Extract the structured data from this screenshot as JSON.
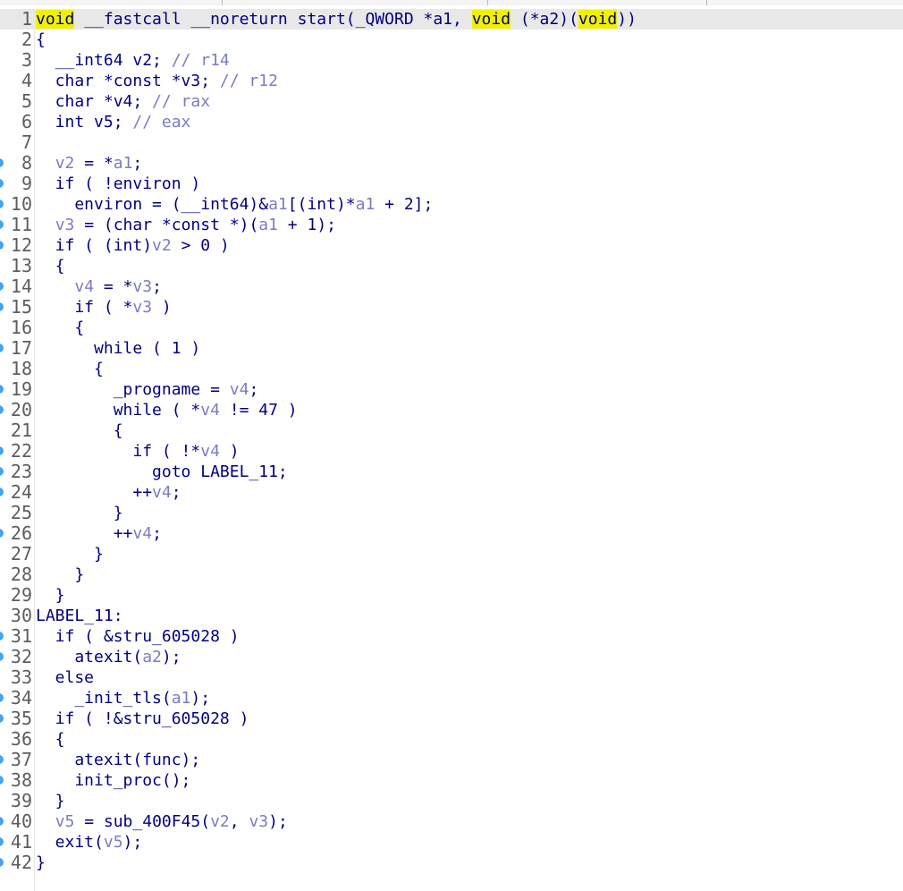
{
  "colors": {
    "highlight": "#f0f000",
    "breakpoint_dot": "#45a3f0",
    "identifier": "#000080",
    "variable": "#7b7bc4",
    "line_number": "#5d5d5d",
    "current_line": "#e8e8e8"
  },
  "editor": {
    "lines": [
      {
        "n": "1",
        "bp": false,
        "current": true,
        "tokens": [
          [
            "hl",
            "void"
          ],
          [
            "tx",
            " __fastcall __noreturn start(_QWORD *a1, "
          ],
          [
            "hl",
            "void"
          ],
          [
            "tx",
            " (*a2)("
          ],
          [
            "hl",
            "void"
          ],
          [
            "tx",
            "))"
          ]
        ]
      },
      {
        "n": "2",
        "bp": false,
        "tokens": [
          [
            "tx",
            "{"
          ]
        ]
      },
      {
        "n": "3",
        "bp": false,
        "tokens": [
          [
            "tx",
            "  __int64 v2; "
          ],
          [
            "cm",
            "// r14"
          ]
        ]
      },
      {
        "n": "4",
        "bp": false,
        "tokens": [
          [
            "tx",
            "  char *const *v3; "
          ],
          [
            "cm",
            "// r12"
          ]
        ]
      },
      {
        "n": "5",
        "bp": false,
        "tokens": [
          [
            "tx",
            "  char *v4; "
          ],
          [
            "cm",
            "// rax"
          ]
        ]
      },
      {
        "n": "6",
        "bp": false,
        "tokens": [
          [
            "tx",
            "  int v5; "
          ],
          [
            "cm",
            "// eax"
          ]
        ]
      },
      {
        "n": "7",
        "bp": false,
        "tokens": []
      },
      {
        "n": "8",
        "bp": true,
        "tokens": [
          [
            "tx",
            "  "
          ],
          [
            "var",
            "v2"
          ],
          [
            "tx",
            " = *"
          ],
          [
            "var",
            "a1"
          ],
          [
            "tx",
            ";"
          ]
        ]
      },
      {
        "n": "9",
        "bp": true,
        "tokens": [
          [
            "tx",
            "  if ( !environ )"
          ]
        ]
      },
      {
        "n": "10",
        "bp": true,
        "tokens": [
          [
            "tx",
            "    environ = (__int64)&"
          ],
          [
            "var",
            "a1"
          ],
          [
            "tx",
            "[(int)*"
          ],
          [
            "var",
            "a1"
          ],
          [
            "tx",
            " + 2];"
          ]
        ]
      },
      {
        "n": "11",
        "bp": true,
        "tokens": [
          [
            "tx",
            "  "
          ],
          [
            "var",
            "v3"
          ],
          [
            "tx",
            " = (char *const *)("
          ],
          [
            "var",
            "a1"
          ],
          [
            "tx",
            " + 1);"
          ]
        ]
      },
      {
        "n": "12",
        "bp": true,
        "tokens": [
          [
            "tx",
            "  if ( (int)"
          ],
          [
            "var",
            "v2"
          ],
          [
            "tx",
            " > 0 )"
          ]
        ]
      },
      {
        "n": "13",
        "bp": false,
        "tokens": [
          [
            "tx",
            "  {"
          ]
        ]
      },
      {
        "n": "14",
        "bp": true,
        "tokens": [
          [
            "tx",
            "    "
          ],
          [
            "var",
            "v4"
          ],
          [
            "tx",
            " = *"
          ],
          [
            "var",
            "v3"
          ],
          [
            "tx",
            ";"
          ]
        ]
      },
      {
        "n": "15",
        "bp": true,
        "tokens": [
          [
            "tx",
            "    if ( *"
          ],
          [
            "var",
            "v3"
          ],
          [
            "tx",
            " )"
          ]
        ]
      },
      {
        "n": "16",
        "bp": false,
        "tokens": [
          [
            "tx",
            "    {"
          ]
        ]
      },
      {
        "n": "17",
        "bp": true,
        "tokens": [
          [
            "tx",
            "      while ( 1 )"
          ]
        ]
      },
      {
        "n": "18",
        "bp": false,
        "tokens": [
          [
            "tx",
            "      {"
          ]
        ]
      },
      {
        "n": "19",
        "bp": true,
        "tokens": [
          [
            "tx",
            "        _progname = "
          ],
          [
            "var",
            "v4"
          ],
          [
            "tx",
            ";"
          ]
        ]
      },
      {
        "n": "20",
        "bp": true,
        "tokens": [
          [
            "tx",
            "        while ( *"
          ],
          [
            "var",
            "v4"
          ],
          [
            "tx",
            " != 47 )"
          ]
        ]
      },
      {
        "n": "21",
        "bp": false,
        "tokens": [
          [
            "tx",
            "        {"
          ]
        ]
      },
      {
        "n": "22",
        "bp": true,
        "tokens": [
          [
            "tx",
            "          if ( !*"
          ],
          [
            "var",
            "v4"
          ],
          [
            "tx",
            " )"
          ]
        ]
      },
      {
        "n": "23",
        "bp": true,
        "tokens": [
          [
            "tx",
            "            goto LABEL_11;"
          ]
        ]
      },
      {
        "n": "24",
        "bp": true,
        "tokens": [
          [
            "tx",
            "          ++"
          ],
          [
            "var",
            "v4"
          ],
          [
            "tx",
            ";"
          ]
        ]
      },
      {
        "n": "25",
        "bp": false,
        "tokens": [
          [
            "tx",
            "        }"
          ]
        ]
      },
      {
        "n": "26",
        "bp": true,
        "tokens": [
          [
            "tx",
            "        ++"
          ],
          [
            "var",
            "v4"
          ],
          [
            "tx",
            ";"
          ]
        ]
      },
      {
        "n": "27",
        "bp": false,
        "tokens": [
          [
            "tx",
            "      }"
          ]
        ]
      },
      {
        "n": "28",
        "bp": false,
        "tokens": [
          [
            "tx",
            "    }"
          ]
        ]
      },
      {
        "n": "29",
        "bp": false,
        "tokens": [
          [
            "tx",
            "  }"
          ]
        ]
      },
      {
        "n": "30",
        "bp": false,
        "tokens": [
          [
            "tx",
            "LABEL_11:"
          ]
        ]
      },
      {
        "n": "31",
        "bp": true,
        "tokens": [
          [
            "tx",
            "  if ( &stru_605028 )"
          ]
        ]
      },
      {
        "n": "32",
        "bp": true,
        "tokens": [
          [
            "tx",
            "    atexit("
          ],
          [
            "var",
            "a2"
          ],
          [
            "tx",
            ");"
          ]
        ]
      },
      {
        "n": "33",
        "bp": false,
        "tokens": [
          [
            "tx",
            "  else"
          ]
        ]
      },
      {
        "n": "34",
        "bp": true,
        "tokens": [
          [
            "tx",
            "    _init_tls("
          ],
          [
            "var",
            "a1"
          ],
          [
            "tx",
            ");"
          ]
        ]
      },
      {
        "n": "35",
        "bp": true,
        "tokens": [
          [
            "tx",
            "  if ( !&stru_605028 )"
          ]
        ]
      },
      {
        "n": "36",
        "bp": false,
        "tokens": [
          [
            "tx",
            "  {"
          ]
        ]
      },
      {
        "n": "37",
        "bp": true,
        "tokens": [
          [
            "tx",
            "    atexit(func);"
          ]
        ]
      },
      {
        "n": "38",
        "bp": true,
        "tokens": [
          [
            "tx",
            "    init_proc();"
          ]
        ]
      },
      {
        "n": "39",
        "bp": false,
        "tokens": [
          [
            "tx",
            "  }"
          ]
        ]
      },
      {
        "n": "40",
        "bp": true,
        "tokens": [
          [
            "tx",
            "  "
          ],
          [
            "var",
            "v5"
          ],
          [
            "tx",
            " = sub_400F45("
          ],
          [
            "var",
            "v2"
          ],
          [
            "tx",
            ", "
          ],
          [
            "var",
            "v3"
          ],
          [
            "tx",
            ");"
          ]
        ]
      },
      {
        "n": "41",
        "bp": true,
        "tokens": [
          [
            "tx",
            "  exit("
          ],
          [
            "var",
            "v5"
          ],
          [
            "tx",
            ");"
          ]
        ]
      },
      {
        "n": "42",
        "bp": true,
        "tokens": [
          [
            "tx",
            "}"
          ]
        ]
      }
    ]
  }
}
